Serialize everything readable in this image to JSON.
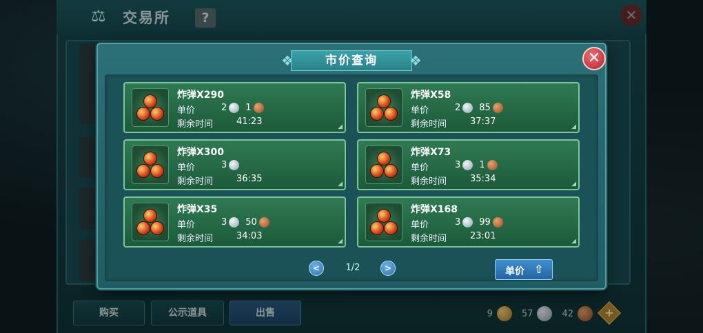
{
  "background": {
    "title": "交易所",
    "help_label": "?",
    "close_label": "✕",
    "bottom_tabs": [
      {
        "label": "购买"
      },
      {
        "label": "公示道具"
      },
      {
        "label": "出售"
      }
    ],
    "currency": [
      {
        "amount": "9",
        "type": "gold"
      },
      {
        "amount": "57",
        "type": "silver"
      },
      {
        "amount": "42",
        "type": "copper"
      }
    ],
    "add_currency_label": "+"
  },
  "modal": {
    "title": "市价查询",
    "close_label": "✕",
    "price_label": "单价",
    "time_label": "剩余时间",
    "listings": [
      {
        "name": "炸弹X290",
        "price": [
          {
            "amount": "2",
            "coin": "silver"
          },
          {
            "amount": "1",
            "coin": "copper"
          }
        ],
        "time": "41:23"
      },
      {
        "name": "炸弹X58",
        "price": [
          {
            "amount": "2",
            "coin": "silver"
          },
          {
            "amount": "85",
            "coin": "copper"
          }
        ],
        "time": "37:37"
      },
      {
        "name": "炸弹X300",
        "price": [
          {
            "amount": "3",
            "coin": "silver"
          }
        ],
        "time": "36:35"
      },
      {
        "name": "炸弹X73",
        "price": [
          {
            "amount": "3",
            "coin": "silver"
          },
          {
            "amount": "1",
            "coin": "copper"
          }
        ],
        "time": "35:34"
      },
      {
        "name": "炸弹X35",
        "price": [
          {
            "amount": "3",
            "coin": "silver"
          },
          {
            "amount": "50",
            "coin": "copper"
          }
        ],
        "time": "34:03"
      },
      {
        "name": "炸弹X168",
        "price": [
          {
            "amount": "3",
            "coin": "silver"
          },
          {
            "amount": "99",
            "coin": "copper"
          }
        ],
        "time": "23:01"
      }
    ],
    "pagination": {
      "prev_label": "<",
      "next_label": ">",
      "current": "1/2"
    },
    "sort_button": {
      "label": "单价",
      "icon": "arrow-up-icon"
    }
  },
  "colors": {
    "card_green": "#2f7a52",
    "modal_teal": "#2c7077",
    "close_red": "#b61f2c",
    "button_blue": "#2364a4"
  }
}
